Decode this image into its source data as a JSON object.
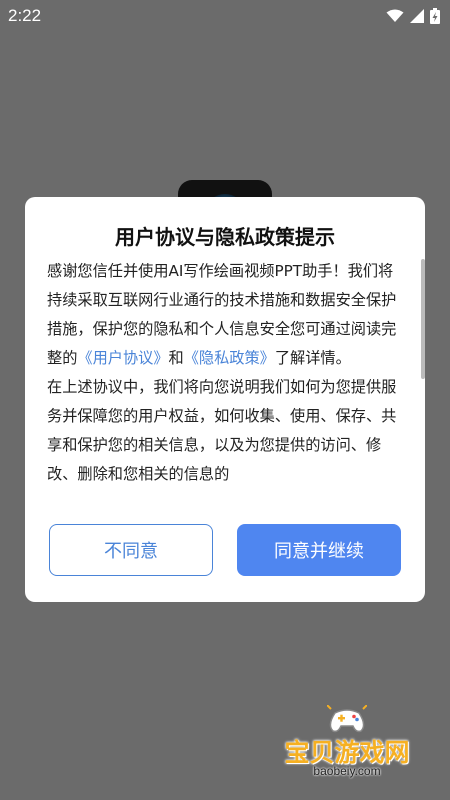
{
  "status_bar": {
    "time": "2:22",
    "icons": [
      "wifi-icon",
      "cellular-signal-icon",
      "battery-charging-icon"
    ]
  },
  "dialog": {
    "title": "用户协议与隐私政策提示",
    "body": {
      "p1_pre": "感谢您信任并使用AI写作绘画视频PPT助手！我们将持续采取互联网行业通行的技术措施和数据安全保护措施，保护您的隐私和个人信息安全您可通过阅读完整的",
      "link_agreement": "《用户协议》",
      "p1_mid": "和",
      "link_privacy": "《隐私政策》",
      "p1_post": "了解详情。",
      "p2": "在上述协议中，我们将向您说明我们如何为您提供服务并保障您的用户权益，如何收集、使用、保存、共享和保护您的相关信息，以及为您提供的访问、修改、删除和您相关的信息的"
    },
    "buttons": {
      "disagree": "不同意",
      "agree": "同意并继续"
    }
  },
  "watermark": {
    "title": "宝贝游戏网",
    "domain": "baobeiy.com"
  },
  "colors": {
    "overlay": "#6b6b6b",
    "link": "#4a84d8",
    "primary_button": "#4f86f0",
    "watermark": "#f6b022"
  }
}
